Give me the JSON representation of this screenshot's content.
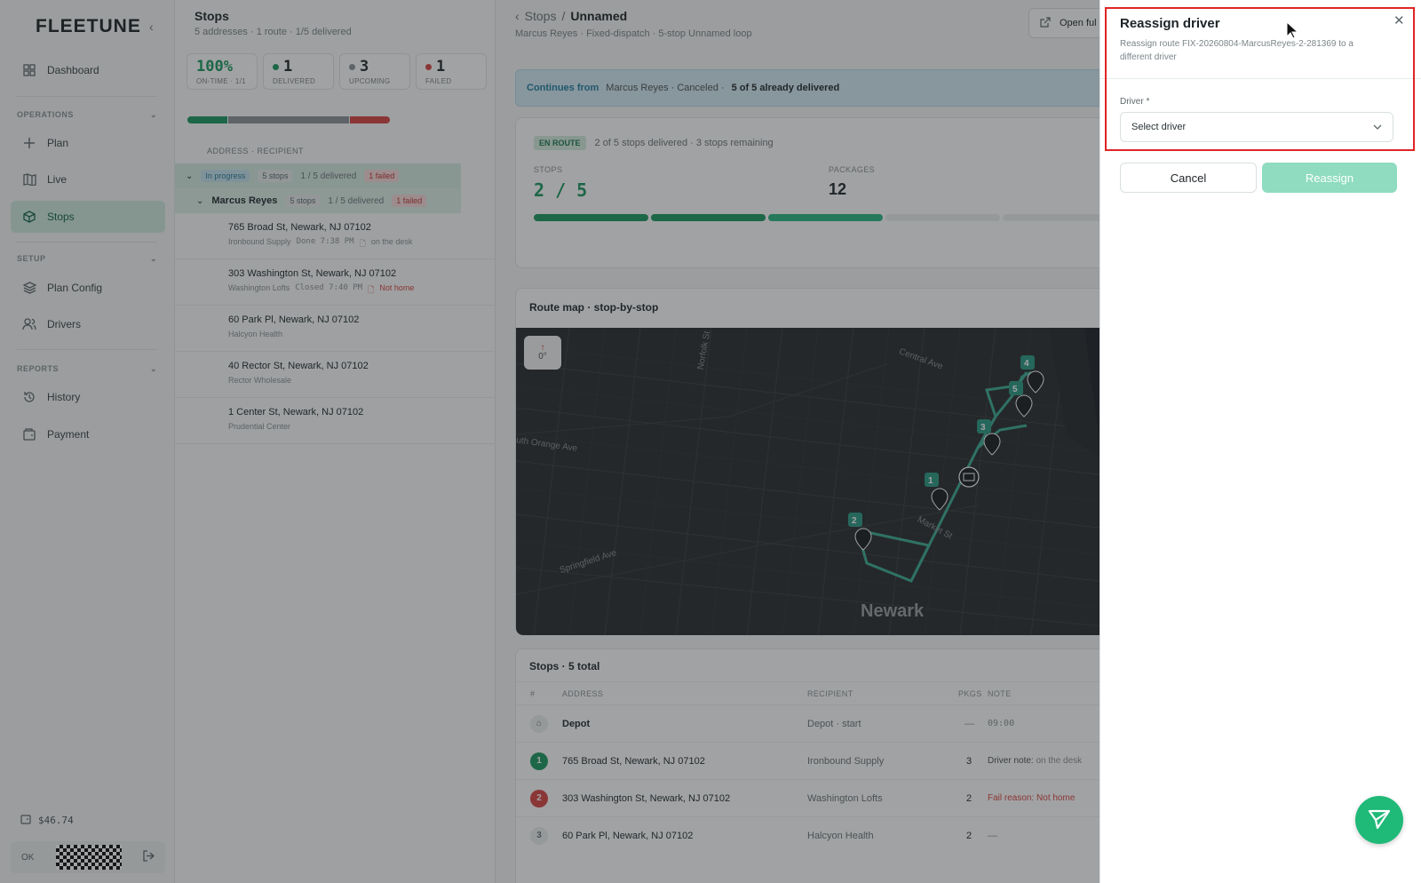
{
  "sidebar": {
    "logo": "FLEETUNE",
    "nav": {
      "dashboard": "Dashboard",
      "operations_label": "OPERATIONS",
      "plan": "Plan",
      "live": "Live",
      "stops": "Stops",
      "setup_label": "SETUP",
      "plan_config": "Plan Config",
      "drivers": "Drivers",
      "reports_label": "REPORTS",
      "history": "History",
      "payment": "Payment"
    },
    "balance": "$46.74",
    "user_initials": "OK"
  },
  "stops_list": {
    "title": "Stops",
    "subtitle": "5 addresses · 1 route · 1/5 delivered",
    "stats": [
      {
        "value": "100%",
        "label": "ON-TIME · 1/1"
      },
      {
        "value": "1",
        "label": "DELIVERED",
        "color": "#1d9a63"
      },
      {
        "value": "3",
        "label": "UPCOMING",
        "color": "#8a9397"
      },
      {
        "value": "1",
        "label": "FAILED",
        "color": "#d84545"
      }
    ],
    "progress": {
      "delivered": 0.2,
      "upcoming": 0.6,
      "failed": 0.2
    },
    "column_header": "ADDRESS · RECIPIENT",
    "group": {
      "status": "In progress",
      "stops": "5 stops",
      "delivered": "1 / 5 delivered",
      "failed": "1 failed"
    },
    "driver_row": {
      "name": "Marcus Reyes",
      "stops": "5 stops",
      "delivered": "1 / 5 delivered",
      "failed": "1 failed"
    },
    "items": [
      {
        "address": "765 Broad St, Newark, NJ 07102",
        "recipient": "Ironbound Supply",
        "status": "Done 7:38 PM",
        "note": "on the desk"
      },
      {
        "address": "303 Washington St, Newark, NJ 07102",
        "recipient": "Washington Lofts",
        "status": "Closed 7:40 PM",
        "note": "Not home"
      },
      {
        "address": "60 Park Pl, Newark, NJ 07102",
        "recipient": "Halcyon Health",
        "status": "",
        "note": ""
      },
      {
        "address": "40 Rector St, Newark, NJ 07102",
        "recipient": "Rector Wholesale",
        "status": "",
        "note": ""
      },
      {
        "address": "1 Center St, Newark, NJ 07102",
        "recipient": "Prudential Center",
        "status": "",
        "note": ""
      }
    ]
  },
  "detail": {
    "breadcrumb_root": "Stops",
    "breadcrumb_current": "Unnamed",
    "subtitle": "Marcus Reyes · Fixed-dispatch · 5-stop Unnamed loop",
    "open_button": "Open ful",
    "banner": {
      "lead": "Continues from",
      "text": "Marcus Reyes · Canceled ·",
      "bold": "5 of 5 already delivered"
    },
    "status_pill": "EN ROUTE",
    "status_text": "2 of 5 stops delivered · 3 stops remaining",
    "stops_label": "STOPS",
    "stops_value": "2 / 5",
    "packages_label": "PACKAGES",
    "packages_value": "12",
    "map_title": "Route map · stop-by-stop",
    "map_compass": "0°",
    "map_labels": {
      "city": "Newark",
      "central_ave": "Central Ave",
      "market_st": "Market St",
      "springfield_ave": "Springfield Ave",
      "south_orange_ave": "uth Orange Ave",
      "norfolk_st": "Norfolk St"
    },
    "table_title": "Stops · 5 total",
    "table_headers": {
      "num": "#",
      "address": "ADDRESS",
      "recipient": "RECIPIENT",
      "pkgs": "PKGS",
      "note": "NOTE"
    },
    "rows": [
      {
        "num": "",
        "address": "Depot",
        "recipient": "Depot · start",
        "pkgs": "—",
        "note": "09:00",
        "note_label": ""
      },
      {
        "num": "1",
        "address": "765 Broad St, Newark, NJ 07102",
        "recipient": "Ironbound Supply",
        "pkgs": "3",
        "note_label": "Driver note:",
        "note": "on the desk"
      },
      {
        "num": "2",
        "address": "303 Washington St, Newark, NJ 07102",
        "recipient": "Washington Lofts",
        "pkgs": "2",
        "note_label": "Fail reason:",
        "note": "Not home"
      },
      {
        "num": "3",
        "address": "60 Park Pl, Newark, NJ 07102",
        "recipient": "Halcyon Health",
        "pkgs": "2",
        "note_label": "",
        "note": "—"
      }
    ]
  },
  "drawer": {
    "title": "Reassign driver",
    "description": "Reassign route FIX-20260804-MarcusReyes-2-281369 to a different driver",
    "driver_label": "Driver *",
    "driver_placeholder": "Select driver",
    "cancel_label": "Cancel",
    "reassign_label": "Reassign"
  },
  "colors": {
    "accent": "#1fb978",
    "failed": "#d84545",
    "delivered": "#1d9a63"
  }
}
